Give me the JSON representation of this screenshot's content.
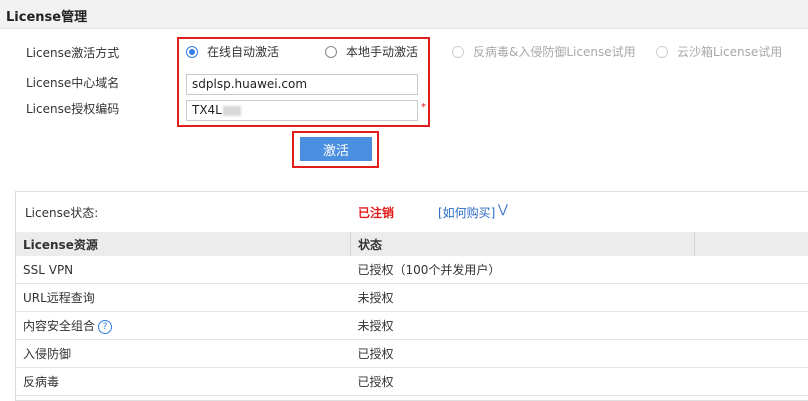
{
  "header": {
    "title": "License管理"
  },
  "form": {
    "activation_mode_label": "License激活方式",
    "options": [
      {
        "label": "在线自动激活",
        "checked": true,
        "disabled": false
      },
      {
        "label": "本地手动激活",
        "checked": false,
        "disabled": false
      },
      {
        "label": "反病毒&入侵防御License试用",
        "checked": false,
        "disabled": true
      },
      {
        "label": "云沙箱License试用",
        "checked": false,
        "disabled": true
      }
    ],
    "domain_label": "License中心域名",
    "domain_value": "sdplsp.huawei.com",
    "auth_code_label": "License授权编码",
    "auth_code_value": "TX4L",
    "required_mark": "*",
    "activate_button": "激活"
  },
  "status": {
    "label": "License状态:",
    "value": "已注销",
    "how_to_buy": "[如何购买]"
  },
  "table": {
    "headers": [
      "License资源",
      "状态"
    ],
    "rows": [
      {
        "resource": "SSL VPN",
        "status": "已授权（100个并发用户）",
        "help": false
      },
      {
        "resource": "URL远程查询",
        "status": "未授权",
        "help": false
      },
      {
        "resource": "内容安全组合",
        "status": "未授权",
        "help": true
      },
      {
        "resource": "入侵防御",
        "status": "已授权",
        "help": false
      },
      {
        "resource": "反病毒",
        "status": "已授权",
        "help": false
      }
    ]
  },
  "colors": {
    "accent": "#4a8fe0",
    "highlight_box": "#e21b1b",
    "status_red": "#e21b1b",
    "link": "#2b6cc4"
  },
  "icons": {
    "help": "question-circle-icon",
    "expand": "chevron-down-icon",
    "radio": "radio-icon"
  }
}
